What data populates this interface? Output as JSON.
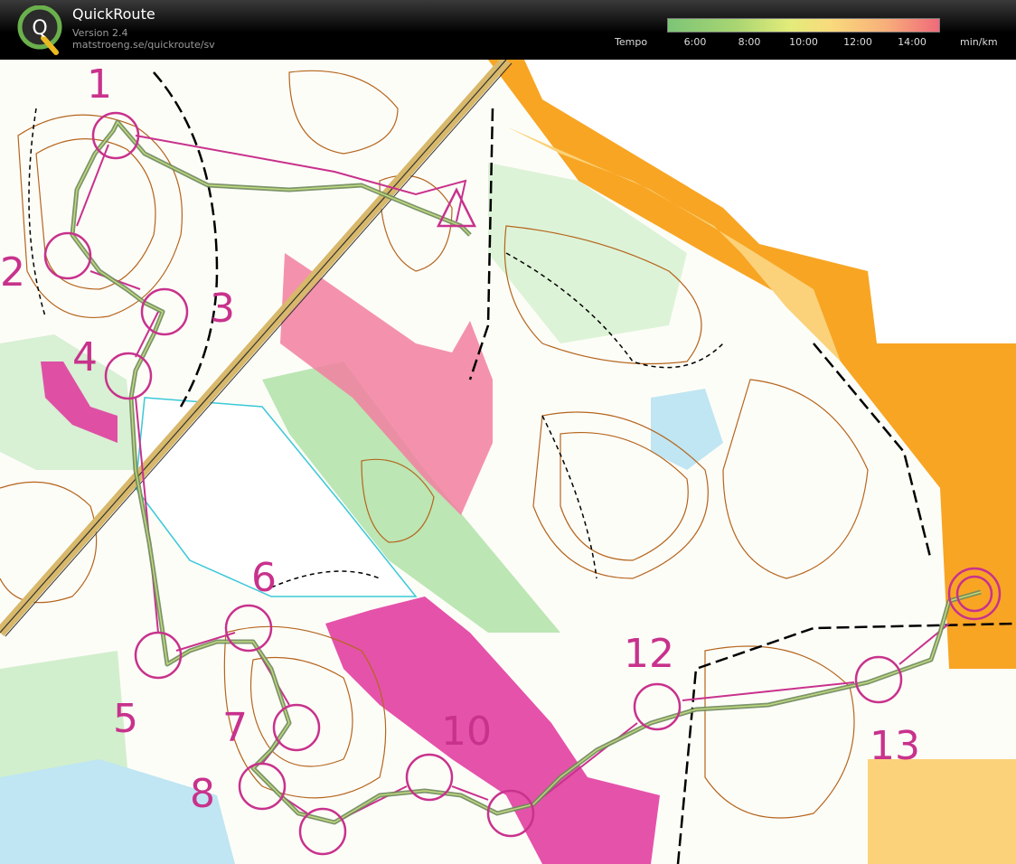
{
  "app": {
    "name": "QuickRoute",
    "version": "Version 2.4",
    "url": "matstroeng.se/quickroute/sv",
    "logo_letter": "Q"
  },
  "tempo_legend": {
    "label": "Tempo",
    "unit": "min/km",
    "ticks": [
      "6:00",
      "8:00",
      "10:00",
      "12:00",
      "14:00"
    ]
  },
  "colors": {
    "course": "#c8328c",
    "route": "#6e8a5c",
    "contour": "#b5651d",
    "forest_green": "#8fd68a",
    "open_land": "#f8a524",
    "restricted": "#e0349c"
  },
  "controls": [
    {
      "label": "1"
    },
    {
      "label": "2"
    },
    {
      "label": "3"
    },
    {
      "label": "4"
    },
    {
      "label": "5"
    },
    {
      "label": "6"
    },
    {
      "label": "7"
    },
    {
      "label": "8"
    },
    {
      "label": "10"
    },
    {
      "label": "12"
    },
    {
      "label": "13"
    }
  ]
}
